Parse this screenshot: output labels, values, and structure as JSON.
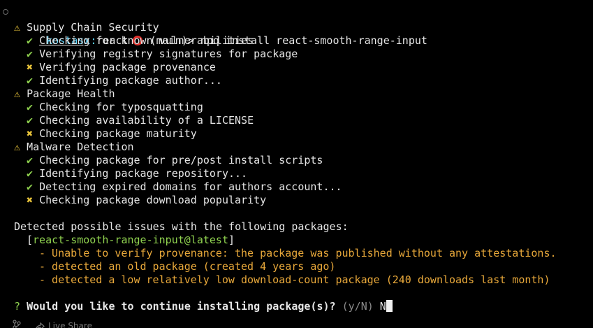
{
  "prompt": {
    "user": "kostasx:",
    "dir": "react",
    "branch": "(main)>",
    "command": "npq install react-smooth-range-input"
  },
  "glyphs": {
    "warn": "⚠",
    "ok": "✔",
    "fail": "✖",
    "question": "?"
  },
  "sections": [
    {
      "title": "Supply Chain Security",
      "checks": [
        {
          "status": "ok",
          "text_prefix": "Checking",
          "text": " for known vulnerabilities"
        },
        {
          "status": "ok",
          "text_prefix": "",
          "text": "Verifying registry signatures for package"
        },
        {
          "status": "fail",
          "text_prefix": "",
          "text": "Verifying package provenance"
        },
        {
          "status": "ok",
          "text_prefix": "",
          "text": "Identifying package author..."
        }
      ]
    },
    {
      "title": "Package Health",
      "checks": [
        {
          "status": "ok",
          "text_prefix": "",
          "text": "Checking for typosquatting"
        },
        {
          "status": "ok",
          "text_prefix": "",
          "text": "Checking availability of a LICENSE"
        },
        {
          "status": "fail",
          "text_prefix": "",
          "text": "Checking package maturity"
        }
      ]
    },
    {
      "title": "Malware Detection",
      "checks": [
        {
          "status": "ok",
          "text_prefix": "",
          "text": "Checking package for pre/post install scripts"
        },
        {
          "status": "ok",
          "text_prefix": "",
          "text": "Identifying package repository..."
        },
        {
          "status": "ok",
          "text_prefix": "",
          "text": "Detecting expired domains for authors account..."
        },
        {
          "status": "fail",
          "text_prefix": "",
          "text": "Checking package download popularity"
        }
      ]
    }
  ],
  "issues": {
    "heading": "Detected possible issues with the following packages:",
    "package_open": "[",
    "package": "react-smooth-range-input@latest",
    "package_close": "]",
    "items": [
      "- Unable to verify provenance: the package was published without any attestations.",
      "- detected an old package (created 4 years ago)",
      "- detected a low relatively low download-count package (240 downloads last month)"
    ]
  },
  "question": {
    "text": "Would you like to continue installing package(s)?",
    "hint": "(y/N)",
    "answer": "N"
  },
  "statusbar": {
    "live_share": "Live Share"
  }
}
